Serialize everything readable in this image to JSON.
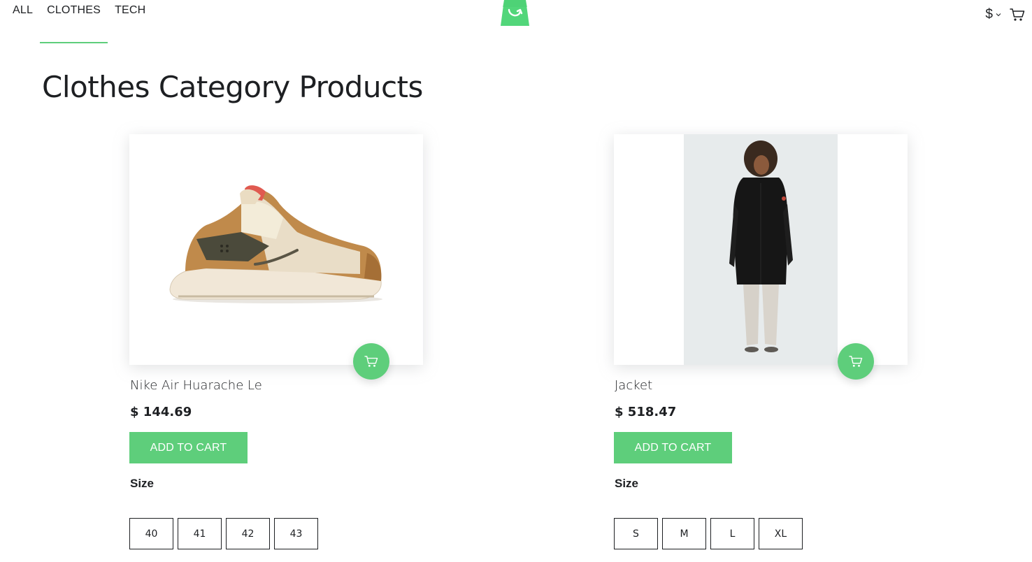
{
  "nav": {
    "items": [
      {
        "label": "ALL"
      },
      {
        "label": "CLOTHES"
      },
      {
        "label": "TECH"
      }
    ],
    "active": "CLOTHES"
  },
  "header": {
    "logo_icon": "shopping-bag-logo-icon",
    "currency_symbol": "$",
    "currency_icon": "chevron-down-icon",
    "cart_icon": "cart-icon"
  },
  "page": {
    "title": "Clothes Category Products"
  },
  "products": [
    {
      "name": "Nike Air Huarache Le",
      "price": "$ 144.69",
      "add_label": "ADD TO CART",
      "size_label": "Size",
      "sizes": [
        "40",
        "41",
        "42",
        "43"
      ]
    },
    {
      "name": "Jacket",
      "price": "$ 518.47",
      "add_label": "ADD TO CART",
      "size_label": "Size",
      "sizes": [
        "S",
        "M",
        "L",
        "XL"
      ]
    }
  ],
  "colors": {
    "accent": "#5ece7b",
    "text": "#1d1f22"
  }
}
